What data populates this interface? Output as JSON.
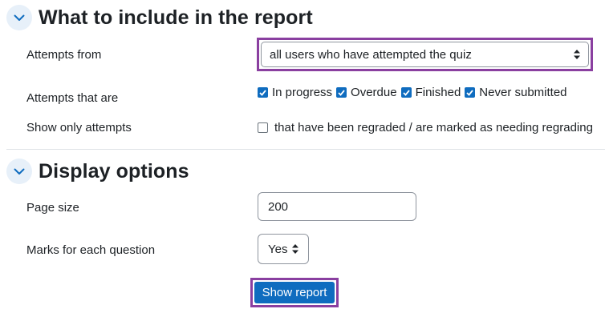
{
  "section_report": {
    "title": "What to include in the report",
    "attempts_from_label": "Attempts from",
    "attempts_from_value": "all users who have attempted the quiz",
    "attempts_state_label": "Attempts that are",
    "states": [
      {
        "label": "In progress",
        "checked": true
      },
      {
        "label": "Overdue",
        "checked": true
      },
      {
        "label": "Finished",
        "checked": true
      },
      {
        "label": "Never submitted",
        "checked": true
      }
    ],
    "show_only_label": "Show only attempts",
    "regraded_label": "that have been regraded / are marked as needing regrading"
  },
  "section_display": {
    "title": "Display options",
    "page_size_label": "Page size",
    "page_size_value": "200",
    "marks_label": "Marks for each question",
    "marks_value": "Yes"
  },
  "actions": {
    "show_report_label": "Show report"
  },
  "colors": {
    "accent": "#0f6cbf",
    "highlight_border": "#8a3fa0",
    "toggle_bg": "#e7f0f9"
  }
}
